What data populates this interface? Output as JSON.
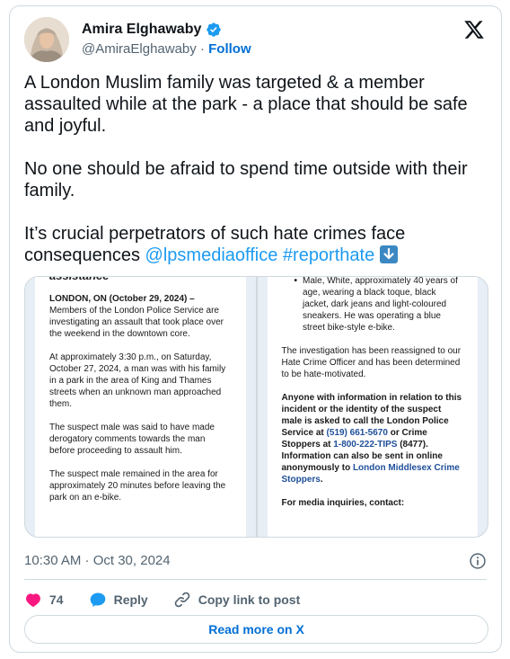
{
  "author": {
    "name": "Amira Elghawaby",
    "handle": "@AmiraElghawaby",
    "separator": "·",
    "follow_label": "Follow"
  },
  "tweet": {
    "paragraph_1": "A London Muslim family was targeted & a member assaulted while at the park - a place that should be safe and joyful.",
    "paragraph_2": "No one should be afraid to spend time outside with their family.",
    "paragraph_3_text": "It’s crucial perpetrators of such hate crimes face consequences ",
    "mention": "@lpsmediaoffice",
    "hashtag": "#reporthate"
  },
  "media": {
    "left": {
      "heading": "assistance",
      "dateline": "LONDON, ON (October 29, 2024) –",
      "para_1": " Members of the London Police Service are investigating an assault that took place over the weekend in the downtown core.",
      "para_2": "At approximately 3:30 p.m., on Saturday, October 27, 2024, a man was with his family in a park in the area of King and Thames streets when an unknown man approached them.",
      "para_3": "The suspect male was said to have made derogatory comments towards the man before proceeding to assault him.",
      "para_4": "The suspect male remained in the area for approximately 20 minutes before leaving the park on an e-bike."
    },
    "right": {
      "bullet": "Male, White, approximately 40 years of age, wearing a black toque, black jacket, dark jeans and light-coloured sneakers. He was operating a blue street bike-style e-bike.",
      "para_1": "The investigation has been reassigned to our Hate Crime Officer and has been determined to be hate-motivated.",
      "info_a": "Anyone with information in relation to this incident or the identity of the suspect male is asked to call the London Police Service at ",
      "phone_1": "(519) 661-5670",
      "info_b": " or Crime Stoppers at ",
      "phone_2": "1-800-222-TIPS",
      "info_c": " (8477). Information can also be sent in online anonymously to ",
      "crime_stoppers": "London Middlesex Crime Stoppers",
      "info_d": ".",
      "media_inquiries": "For media inquiries, contact:"
    }
  },
  "timestamp": "10:30 AM · Oct 30, 2024",
  "actions": {
    "likes": "74",
    "reply": "Reply",
    "copy_link": "Copy link to post"
  },
  "read_more": "Read more on X",
  "colors": {
    "link": "#1d9bf0",
    "follow": "#006fd6",
    "heart": "#f91880",
    "reply_bubble": "#1d9bf0",
    "muted": "#536471"
  },
  "icons": [
    "verified-badge-icon",
    "x-logo-icon",
    "arrow-down-emoji-icon",
    "info-icon",
    "heart-icon",
    "reply-icon",
    "link-icon"
  ]
}
